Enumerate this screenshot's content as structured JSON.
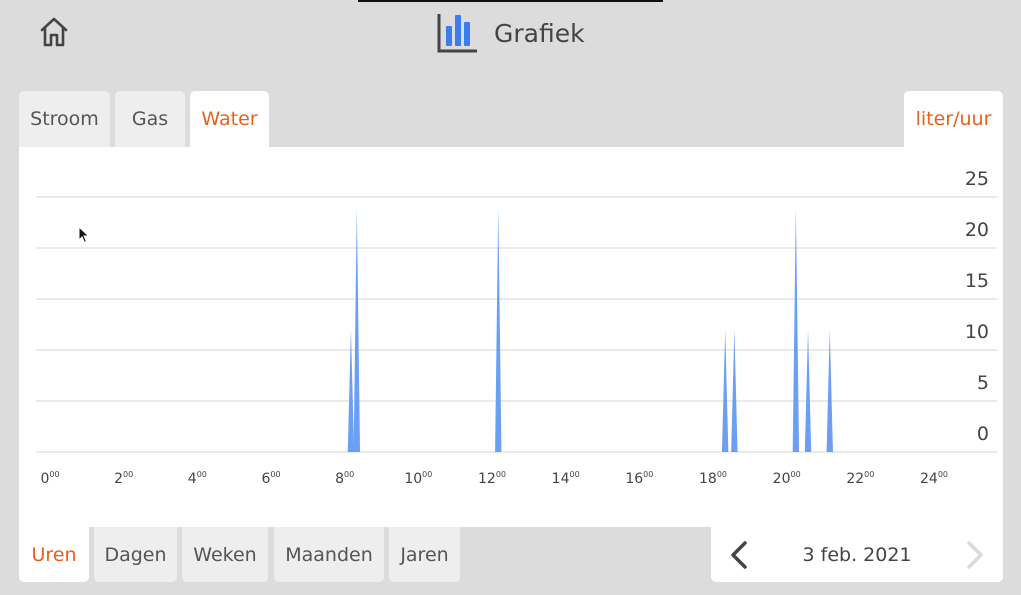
{
  "header": {
    "title": "Grafiek",
    "home_icon": "home-icon",
    "chart_icon": "bar-chart-icon"
  },
  "tabs": [
    {
      "label": "Stroom",
      "active": false
    },
    {
      "label": "Gas",
      "active": false
    },
    {
      "label": "Water",
      "active": true
    }
  ],
  "unit_label": "liter/uur",
  "period_tabs": [
    {
      "label": "Uren",
      "active": true
    },
    {
      "label": "Dagen",
      "active": false
    },
    {
      "label": "Weken",
      "active": false
    },
    {
      "label": "Maanden",
      "active": false
    },
    {
      "label": "Jaren",
      "active": false
    }
  ],
  "date_nav": {
    "date": "3 feb. 2021",
    "prev_icon": "chevron-left-icon",
    "next_icon": "chevron-right-icon",
    "next_enabled": false
  },
  "colors": {
    "accent": "#e8601c",
    "series": "#6a9ff4",
    "chart_icon": "#3b7df0"
  },
  "chart_data": {
    "type": "area",
    "xlabel": "",
    "ylabel": "",
    "ylim": [
      0,
      25
    ],
    "yticks": [
      "0",
      "5",
      "10",
      "15",
      "20",
      "25"
    ],
    "xticks": [
      {
        "h": "0",
        "m": "00"
      },
      {
        "h": "2",
        "m": "00"
      },
      {
        "h": "4",
        "m": "00"
      },
      {
        "h": "6",
        "m": "00"
      },
      {
        "h": "8",
        "m": "00"
      },
      {
        "h": "10",
        "m": "00"
      },
      {
        "h": "12",
        "m": "00"
      },
      {
        "h": "14",
        "m": "00"
      },
      {
        "h": "16",
        "m": "00"
      },
      {
        "h": "18",
        "m": "00"
      },
      {
        "h": "20",
        "m": "00"
      },
      {
        "h": "22",
        "m": "00"
      },
      {
        "h": "24",
        "m": "00"
      }
    ],
    "xlim": [
      0,
      24
    ],
    "series": [
      {
        "points": [
          {
            "x": 8.17,
            "y": 12
          },
          {
            "x": 8.33,
            "y": 24
          },
          {
            "x": 12.17,
            "y": 24
          },
          {
            "x": 18.33,
            "y": 12
          },
          {
            "x": 18.58,
            "y": 12
          },
          {
            "x": 20.25,
            "y": 24
          },
          {
            "x": 20.58,
            "y": 12
          },
          {
            "x": 21.17,
            "y": 12
          }
        ]
      }
    ],
    "grid": true
  }
}
